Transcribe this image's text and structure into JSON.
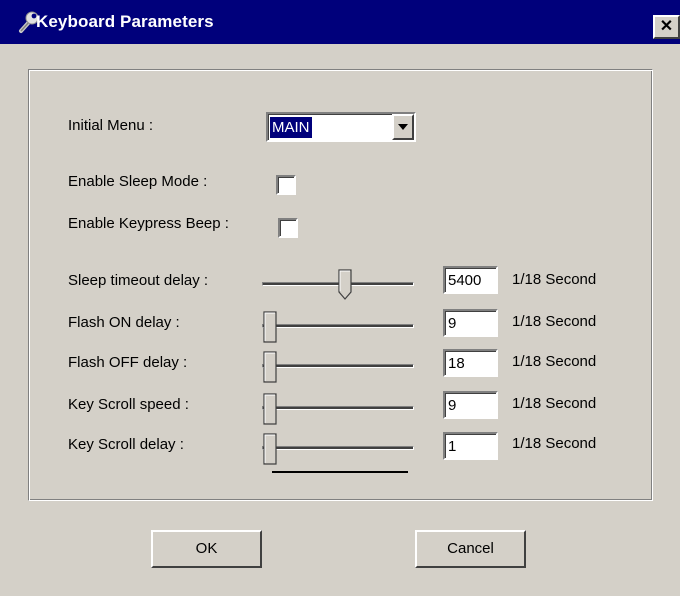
{
  "window": {
    "title": "Keyboard Parameters",
    "close_glyph": "✕",
    "icon": "wrench-icon"
  },
  "colors": {
    "titlebar": "#00007b",
    "face": "#d4d0c8",
    "selection": "#00007b"
  },
  "initial_menu": {
    "label": "Initial Menu :",
    "value": "MAIN"
  },
  "sleep_mode": {
    "label": "Enable Sleep Mode :",
    "checked": false
  },
  "keypress_beep": {
    "label": "Enable Keypress Beep :",
    "checked": false
  },
  "sliders": [
    {
      "label": "Sleep timeout delay :",
      "value": "5400",
      "unit": "1/18 Second",
      "position": 0.55
    },
    {
      "label": "Flash ON delay :",
      "value": "9",
      "unit": "1/18 Second",
      "position": 0.0
    },
    {
      "label": "Flash OFF delay :",
      "value": "18",
      "unit": "1/18 Second",
      "position": 0.0
    },
    {
      "label": "Key Scroll speed :",
      "value": "9",
      "unit": "1/18 Second",
      "position": 0.0
    },
    {
      "label": "Key Scroll delay :",
      "value": "1",
      "unit": "1/18 Second",
      "position": 0.0
    }
  ],
  "buttons": {
    "ok": "OK",
    "cancel": "Cancel"
  }
}
